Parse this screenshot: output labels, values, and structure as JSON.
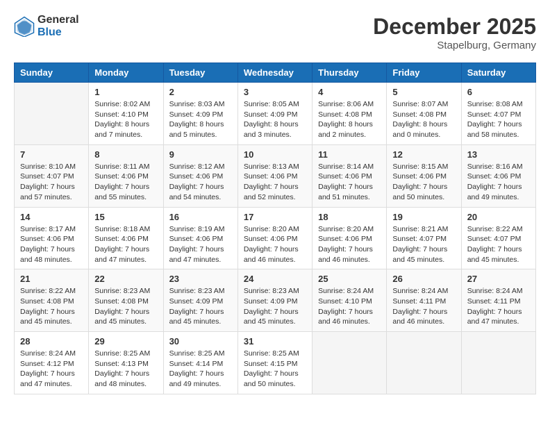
{
  "header": {
    "logo_general": "General",
    "logo_blue": "Blue",
    "month_title": "December 2025",
    "location": "Stapelburg, Germany"
  },
  "weekdays": [
    "Sunday",
    "Monday",
    "Tuesday",
    "Wednesday",
    "Thursday",
    "Friday",
    "Saturday"
  ],
  "weeks": [
    [
      {
        "day": "",
        "sunrise": "",
        "sunset": "",
        "daylight": ""
      },
      {
        "day": "1",
        "sunrise": "Sunrise: 8:02 AM",
        "sunset": "Sunset: 4:10 PM",
        "daylight": "Daylight: 8 hours and 7 minutes."
      },
      {
        "day": "2",
        "sunrise": "Sunrise: 8:03 AM",
        "sunset": "Sunset: 4:09 PM",
        "daylight": "Daylight: 8 hours and 5 minutes."
      },
      {
        "day": "3",
        "sunrise": "Sunrise: 8:05 AM",
        "sunset": "Sunset: 4:09 PM",
        "daylight": "Daylight: 8 hours and 3 minutes."
      },
      {
        "day": "4",
        "sunrise": "Sunrise: 8:06 AM",
        "sunset": "Sunset: 4:08 PM",
        "daylight": "Daylight: 8 hours and 2 minutes."
      },
      {
        "day": "5",
        "sunrise": "Sunrise: 8:07 AM",
        "sunset": "Sunset: 4:08 PM",
        "daylight": "Daylight: 8 hours and 0 minutes."
      },
      {
        "day": "6",
        "sunrise": "Sunrise: 8:08 AM",
        "sunset": "Sunset: 4:07 PM",
        "daylight": "Daylight: 7 hours and 58 minutes."
      }
    ],
    [
      {
        "day": "7",
        "sunrise": "Sunrise: 8:10 AM",
        "sunset": "Sunset: 4:07 PM",
        "daylight": "Daylight: 7 hours and 57 minutes."
      },
      {
        "day": "8",
        "sunrise": "Sunrise: 8:11 AM",
        "sunset": "Sunset: 4:06 PM",
        "daylight": "Daylight: 7 hours and 55 minutes."
      },
      {
        "day": "9",
        "sunrise": "Sunrise: 8:12 AM",
        "sunset": "Sunset: 4:06 PM",
        "daylight": "Daylight: 7 hours and 54 minutes."
      },
      {
        "day": "10",
        "sunrise": "Sunrise: 8:13 AM",
        "sunset": "Sunset: 4:06 PM",
        "daylight": "Daylight: 7 hours and 52 minutes."
      },
      {
        "day": "11",
        "sunrise": "Sunrise: 8:14 AM",
        "sunset": "Sunset: 4:06 PM",
        "daylight": "Daylight: 7 hours and 51 minutes."
      },
      {
        "day": "12",
        "sunrise": "Sunrise: 8:15 AM",
        "sunset": "Sunset: 4:06 PM",
        "daylight": "Daylight: 7 hours and 50 minutes."
      },
      {
        "day": "13",
        "sunrise": "Sunrise: 8:16 AM",
        "sunset": "Sunset: 4:06 PM",
        "daylight": "Daylight: 7 hours and 49 minutes."
      }
    ],
    [
      {
        "day": "14",
        "sunrise": "Sunrise: 8:17 AM",
        "sunset": "Sunset: 4:06 PM",
        "daylight": "Daylight: 7 hours and 48 minutes."
      },
      {
        "day": "15",
        "sunrise": "Sunrise: 8:18 AM",
        "sunset": "Sunset: 4:06 PM",
        "daylight": "Daylight: 7 hours and 47 minutes."
      },
      {
        "day": "16",
        "sunrise": "Sunrise: 8:19 AM",
        "sunset": "Sunset: 4:06 PM",
        "daylight": "Daylight: 7 hours and 47 minutes."
      },
      {
        "day": "17",
        "sunrise": "Sunrise: 8:20 AM",
        "sunset": "Sunset: 4:06 PM",
        "daylight": "Daylight: 7 hours and 46 minutes."
      },
      {
        "day": "18",
        "sunrise": "Sunrise: 8:20 AM",
        "sunset": "Sunset: 4:06 PM",
        "daylight": "Daylight: 7 hours and 46 minutes."
      },
      {
        "day": "19",
        "sunrise": "Sunrise: 8:21 AM",
        "sunset": "Sunset: 4:07 PM",
        "daylight": "Daylight: 7 hours and 45 minutes."
      },
      {
        "day": "20",
        "sunrise": "Sunrise: 8:22 AM",
        "sunset": "Sunset: 4:07 PM",
        "daylight": "Daylight: 7 hours and 45 minutes."
      }
    ],
    [
      {
        "day": "21",
        "sunrise": "Sunrise: 8:22 AM",
        "sunset": "Sunset: 4:08 PM",
        "daylight": "Daylight: 7 hours and 45 minutes."
      },
      {
        "day": "22",
        "sunrise": "Sunrise: 8:23 AM",
        "sunset": "Sunset: 4:08 PM",
        "daylight": "Daylight: 7 hours and 45 minutes."
      },
      {
        "day": "23",
        "sunrise": "Sunrise: 8:23 AM",
        "sunset": "Sunset: 4:09 PM",
        "daylight": "Daylight: 7 hours and 45 minutes."
      },
      {
        "day": "24",
        "sunrise": "Sunrise: 8:23 AM",
        "sunset": "Sunset: 4:09 PM",
        "daylight": "Daylight: 7 hours and 45 minutes."
      },
      {
        "day": "25",
        "sunrise": "Sunrise: 8:24 AM",
        "sunset": "Sunset: 4:10 PM",
        "daylight": "Daylight: 7 hours and 46 minutes."
      },
      {
        "day": "26",
        "sunrise": "Sunrise: 8:24 AM",
        "sunset": "Sunset: 4:11 PM",
        "daylight": "Daylight: 7 hours and 46 minutes."
      },
      {
        "day": "27",
        "sunrise": "Sunrise: 8:24 AM",
        "sunset": "Sunset: 4:11 PM",
        "daylight": "Daylight: 7 hours and 47 minutes."
      }
    ],
    [
      {
        "day": "28",
        "sunrise": "Sunrise: 8:24 AM",
        "sunset": "Sunset: 4:12 PM",
        "daylight": "Daylight: 7 hours and 47 minutes."
      },
      {
        "day": "29",
        "sunrise": "Sunrise: 8:25 AM",
        "sunset": "Sunset: 4:13 PM",
        "daylight": "Daylight: 7 hours and 48 minutes."
      },
      {
        "day": "30",
        "sunrise": "Sunrise: 8:25 AM",
        "sunset": "Sunset: 4:14 PM",
        "daylight": "Daylight: 7 hours and 49 minutes."
      },
      {
        "day": "31",
        "sunrise": "Sunrise: 8:25 AM",
        "sunset": "Sunset: 4:15 PM",
        "daylight": "Daylight: 7 hours and 50 minutes."
      },
      {
        "day": "",
        "sunrise": "",
        "sunset": "",
        "daylight": ""
      },
      {
        "day": "",
        "sunrise": "",
        "sunset": "",
        "daylight": ""
      },
      {
        "day": "",
        "sunrise": "",
        "sunset": "",
        "daylight": ""
      }
    ]
  ]
}
